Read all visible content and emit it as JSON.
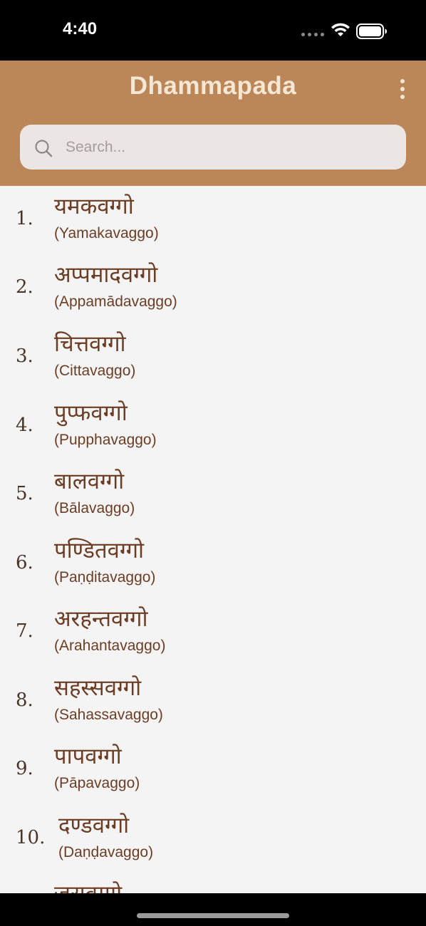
{
  "status_bar": {
    "time": "4:40",
    "icons": [
      "signal-dots-icon",
      "wifi-icon",
      "battery-icon"
    ]
  },
  "header": {
    "title": "Dhammapada",
    "menu_icon": "more-vertical-icon",
    "background_color": "#bb8658",
    "title_color": "#f6e7d5"
  },
  "search": {
    "placeholder": "Search...",
    "value": "",
    "icon": "search-icon"
  },
  "chapters": [
    {
      "number": "1.",
      "title": "यमकवग्गो",
      "subtitle": "(Yamakavaggo)"
    },
    {
      "number": "2.",
      "title": "अप्पमादवग्गो",
      "subtitle": "(Appamādavaggo)"
    },
    {
      "number": "3.",
      "title": "चित्तवग्गो",
      "subtitle": "(Cittavaggo)"
    },
    {
      "number": "4.",
      "title": "पुप्फवग्गो",
      "subtitle": "(Pupphavaggo)"
    },
    {
      "number": "5.",
      "title": "बालवग्गो",
      "subtitle": "(Bālavaggo)"
    },
    {
      "number": "6.",
      "title": "पण्डितवग्गो",
      "subtitle": "(Paṇḍitavaggo)"
    },
    {
      "number": "7.",
      "title": "अरहन्तवग्गो",
      "subtitle": "(Arahantavaggo)"
    },
    {
      "number": "8.",
      "title": "सहस्सवग्गो",
      "subtitle": "(Sahassavaggo)"
    },
    {
      "number": "9.",
      "title": "पापवग्गो",
      "subtitle": "(Pāpavaggo)"
    },
    {
      "number": "10.",
      "title": "दण्डवग्गो",
      "subtitle": "(Daṇḍavaggo)"
    },
    {
      "number": "",
      "title": "जरावग्गो",
      "subtitle": ""
    }
  ],
  "colors": {
    "list_background": "#f5f4f4",
    "text_brown": "#6b3d25"
  }
}
